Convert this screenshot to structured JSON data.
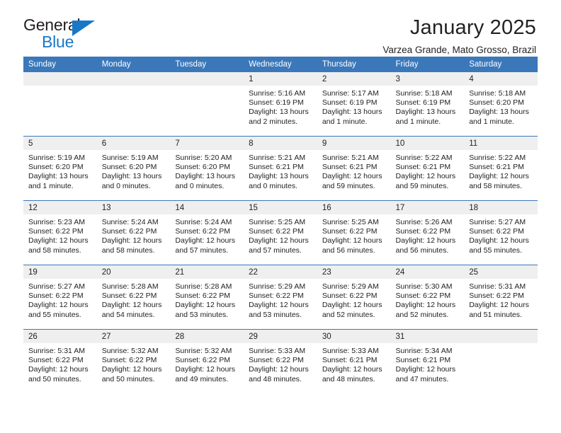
{
  "brand": {
    "name_part1": "General",
    "name_part2": "Blue",
    "accent_color": "#1878c8"
  },
  "header": {
    "title": "January 2025",
    "location": "Varzea Grande, Mato Grosso, Brazil"
  },
  "calendar": {
    "header_color": "#3a78ba",
    "daynum_band_color": "#efefef",
    "weekday_headers": [
      "Sunday",
      "Monday",
      "Tuesday",
      "Wednesday",
      "Thursday",
      "Friday",
      "Saturday"
    ],
    "weeks": [
      [
        {
          "day": "",
          "sunrise": "",
          "sunset": "",
          "daylight": ""
        },
        {
          "day": "",
          "sunrise": "",
          "sunset": "",
          "daylight": ""
        },
        {
          "day": "",
          "sunrise": "",
          "sunset": "",
          "daylight": ""
        },
        {
          "day": "1",
          "sunrise": "Sunrise: 5:16 AM",
          "sunset": "Sunset: 6:19 PM",
          "daylight": "Daylight: 13 hours and 2 minutes."
        },
        {
          "day": "2",
          "sunrise": "Sunrise: 5:17 AM",
          "sunset": "Sunset: 6:19 PM",
          "daylight": "Daylight: 13 hours and 1 minute."
        },
        {
          "day": "3",
          "sunrise": "Sunrise: 5:18 AM",
          "sunset": "Sunset: 6:19 PM",
          "daylight": "Daylight: 13 hours and 1 minute."
        },
        {
          "day": "4",
          "sunrise": "Sunrise: 5:18 AM",
          "sunset": "Sunset: 6:20 PM",
          "daylight": "Daylight: 13 hours and 1 minute."
        }
      ],
      [
        {
          "day": "5",
          "sunrise": "Sunrise: 5:19 AM",
          "sunset": "Sunset: 6:20 PM",
          "daylight": "Daylight: 13 hours and 1 minute."
        },
        {
          "day": "6",
          "sunrise": "Sunrise: 5:19 AM",
          "sunset": "Sunset: 6:20 PM",
          "daylight": "Daylight: 13 hours and 0 minutes."
        },
        {
          "day": "7",
          "sunrise": "Sunrise: 5:20 AM",
          "sunset": "Sunset: 6:20 PM",
          "daylight": "Daylight: 13 hours and 0 minutes."
        },
        {
          "day": "8",
          "sunrise": "Sunrise: 5:21 AM",
          "sunset": "Sunset: 6:21 PM",
          "daylight": "Daylight: 13 hours and 0 minutes."
        },
        {
          "day": "9",
          "sunrise": "Sunrise: 5:21 AM",
          "sunset": "Sunset: 6:21 PM",
          "daylight": "Daylight: 12 hours and 59 minutes."
        },
        {
          "day": "10",
          "sunrise": "Sunrise: 5:22 AM",
          "sunset": "Sunset: 6:21 PM",
          "daylight": "Daylight: 12 hours and 59 minutes."
        },
        {
          "day": "11",
          "sunrise": "Sunrise: 5:22 AM",
          "sunset": "Sunset: 6:21 PM",
          "daylight": "Daylight: 12 hours and 58 minutes."
        }
      ],
      [
        {
          "day": "12",
          "sunrise": "Sunrise: 5:23 AM",
          "sunset": "Sunset: 6:22 PM",
          "daylight": "Daylight: 12 hours and 58 minutes."
        },
        {
          "day": "13",
          "sunrise": "Sunrise: 5:24 AM",
          "sunset": "Sunset: 6:22 PM",
          "daylight": "Daylight: 12 hours and 58 minutes."
        },
        {
          "day": "14",
          "sunrise": "Sunrise: 5:24 AM",
          "sunset": "Sunset: 6:22 PM",
          "daylight": "Daylight: 12 hours and 57 minutes."
        },
        {
          "day": "15",
          "sunrise": "Sunrise: 5:25 AM",
          "sunset": "Sunset: 6:22 PM",
          "daylight": "Daylight: 12 hours and 57 minutes."
        },
        {
          "day": "16",
          "sunrise": "Sunrise: 5:25 AM",
          "sunset": "Sunset: 6:22 PM",
          "daylight": "Daylight: 12 hours and 56 minutes."
        },
        {
          "day": "17",
          "sunrise": "Sunrise: 5:26 AM",
          "sunset": "Sunset: 6:22 PM",
          "daylight": "Daylight: 12 hours and 56 minutes."
        },
        {
          "day": "18",
          "sunrise": "Sunrise: 5:27 AM",
          "sunset": "Sunset: 6:22 PM",
          "daylight": "Daylight: 12 hours and 55 minutes."
        }
      ],
      [
        {
          "day": "19",
          "sunrise": "Sunrise: 5:27 AM",
          "sunset": "Sunset: 6:22 PM",
          "daylight": "Daylight: 12 hours and 55 minutes."
        },
        {
          "day": "20",
          "sunrise": "Sunrise: 5:28 AM",
          "sunset": "Sunset: 6:22 PM",
          "daylight": "Daylight: 12 hours and 54 minutes."
        },
        {
          "day": "21",
          "sunrise": "Sunrise: 5:28 AM",
          "sunset": "Sunset: 6:22 PM",
          "daylight": "Daylight: 12 hours and 53 minutes."
        },
        {
          "day": "22",
          "sunrise": "Sunrise: 5:29 AM",
          "sunset": "Sunset: 6:22 PM",
          "daylight": "Daylight: 12 hours and 53 minutes."
        },
        {
          "day": "23",
          "sunrise": "Sunrise: 5:29 AM",
          "sunset": "Sunset: 6:22 PM",
          "daylight": "Daylight: 12 hours and 52 minutes."
        },
        {
          "day": "24",
          "sunrise": "Sunrise: 5:30 AM",
          "sunset": "Sunset: 6:22 PM",
          "daylight": "Daylight: 12 hours and 52 minutes."
        },
        {
          "day": "25",
          "sunrise": "Sunrise: 5:31 AM",
          "sunset": "Sunset: 6:22 PM",
          "daylight": "Daylight: 12 hours and 51 minutes."
        }
      ],
      [
        {
          "day": "26",
          "sunrise": "Sunrise: 5:31 AM",
          "sunset": "Sunset: 6:22 PM",
          "daylight": "Daylight: 12 hours and 50 minutes."
        },
        {
          "day": "27",
          "sunrise": "Sunrise: 5:32 AM",
          "sunset": "Sunset: 6:22 PM",
          "daylight": "Daylight: 12 hours and 50 minutes."
        },
        {
          "day": "28",
          "sunrise": "Sunrise: 5:32 AM",
          "sunset": "Sunset: 6:22 PM",
          "daylight": "Daylight: 12 hours and 49 minutes."
        },
        {
          "day": "29",
          "sunrise": "Sunrise: 5:33 AM",
          "sunset": "Sunset: 6:22 PM",
          "daylight": "Daylight: 12 hours and 48 minutes."
        },
        {
          "day": "30",
          "sunrise": "Sunrise: 5:33 AM",
          "sunset": "Sunset: 6:21 PM",
          "daylight": "Daylight: 12 hours and 48 minutes."
        },
        {
          "day": "31",
          "sunrise": "Sunrise: 5:34 AM",
          "sunset": "Sunset: 6:21 PM",
          "daylight": "Daylight: 12 hours and 47 minutes."
        },
        {
          "day": "",
          "sunrise": "",
          "sunset": "",
          "daylight": ""
        }
      ]
    ]
  }
}
